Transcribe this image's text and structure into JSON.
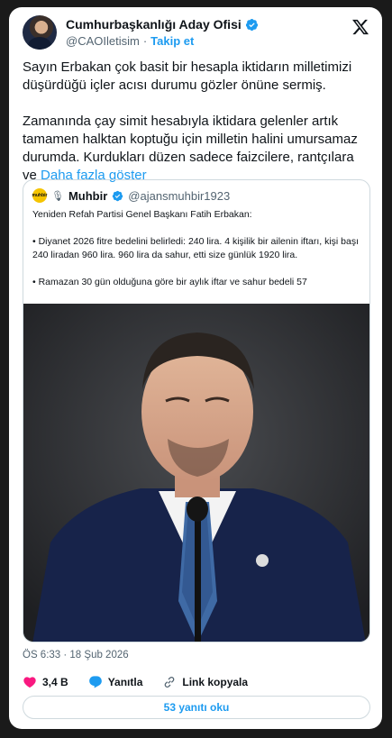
{
  "author": {
    "name": "Cumhurbaşkanlığı Aday Ofisi",
    "handle": "@CAOIletisim",
    "separator": "·",
    "follow_label": "Takip et"
  },
  "tweet": {
    "paragraph1": "Sayın Erbakan çok basit bir hesapla iktidarın milletimizi düşürdüğü içler acısı durumu gözler önüne sermiş.",
    "paragraph2": "Zamanında çay simit hesabıyla iktidara gelenler artık tamamen halktan koptuğu için milletin halini umursamaz durumda. Kurdukları düzen sadece faizcilere, rantçılara ve",
    "show_more": "Daha fazla göster"
  },
  "quote": {
    "avatar_text": "muhbir",
    "name": "Muhbir",
    "handle": "@ajansmuhbir1923",
    "line1": "Yeniden Refah Partisi Genel Başkanı Fatih Erbakan:",
    "line2": "• Diyanet 2026 fitre bedelini belirledi: 240 lira. 4 kişilik bir ailenin iftarı, kişi başı 240 liradan 960 lira. 960 lira da sahur, etti size günlük 1920 lira.",
    "line3": "• Ramazan 30 gün olduğuna göre bir aylık iftar ve sahur bedeli 57"
  },
  "timestamp": "ÖS 6:33 · 18 Şub 2026",
  "actions": {
    "likes": "3,4 B",
    "reply_label": "Yanıtla",
    "copy_link_label": "Link kopyala"
  },
  "read_replies_label": "53 yanıtı oku",
  "colors": {
    "accent": "#1d9bf0",
    "like": "#f91880",
    "text": "#0f1419",
    "secondary": "#536471"
  }
}
